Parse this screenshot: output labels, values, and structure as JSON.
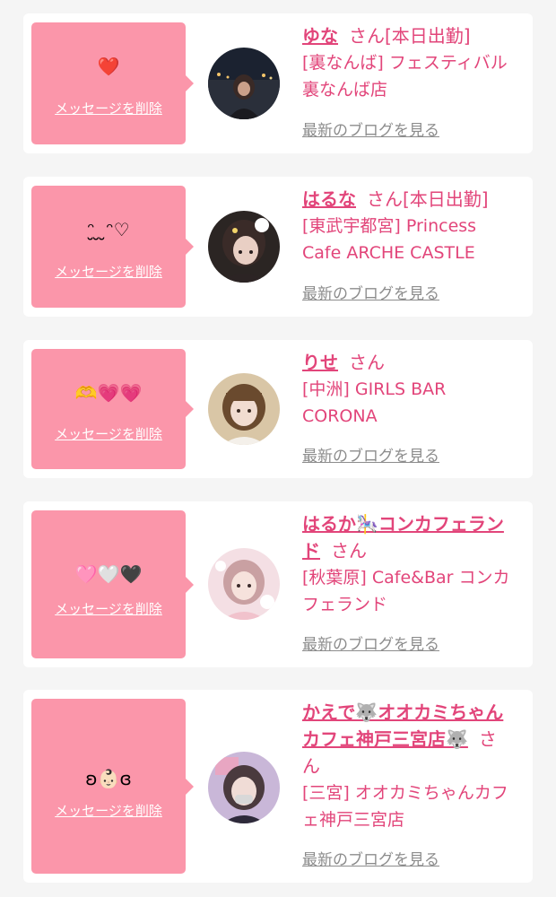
{
  "common": {
    "san": "さん",
    "delete_label": "メッセージを削除",
    "blog_label": "最新のブログを見る"
  },
  "cards": [
    {
      "message": "❤️",
      "name": "ゆな",
      "status": "[本日出勤]",
      "shop_lines": [
        "[裏なんば] フェスティバル",
        "裏なんば店"
      ]
    },
    {
      "message": "ᵔ̮ ̮ ̮ᵔ♡",
      "name": "はるな",
      "status": "[本日出勤]",
      "shop_lines": [
        "[東武宇都宮] Princess",
        "Cafe ARCHE CASTLE"
      ]
    },
    {
      "message": "🫶💗💗",
      "name": "りせ",
      "status": "",
      "shop_lines": [
        "[中洲] GIRLS BAR",
        "CORONA"
      ]
    },
    {
      "message": "🩷🤍🖤",
      "name_lines": [
        "はるか🎠コンカフェラン",
        "ド"
      ],
      "status": "",
      "shop_lines": [
        "[秋葉原] Cafe&Bar コンカ",
        "フェランド"
      ]
    },
    {
      "message": "ʚ👶🏻ɞ",
      "name_lines": [
        "かえで🐺オオカミちゃん",
        "カフェ神戸三宮店🐺"
      ],
      "san_split": [
        "さ",
        "ん"
      ],
      "status": "",
      "shop_lines": [
        "[三宮] オオカミちゃんカフ",
        "ェ神戸三宮店"
      ]
    }
  ]
}
